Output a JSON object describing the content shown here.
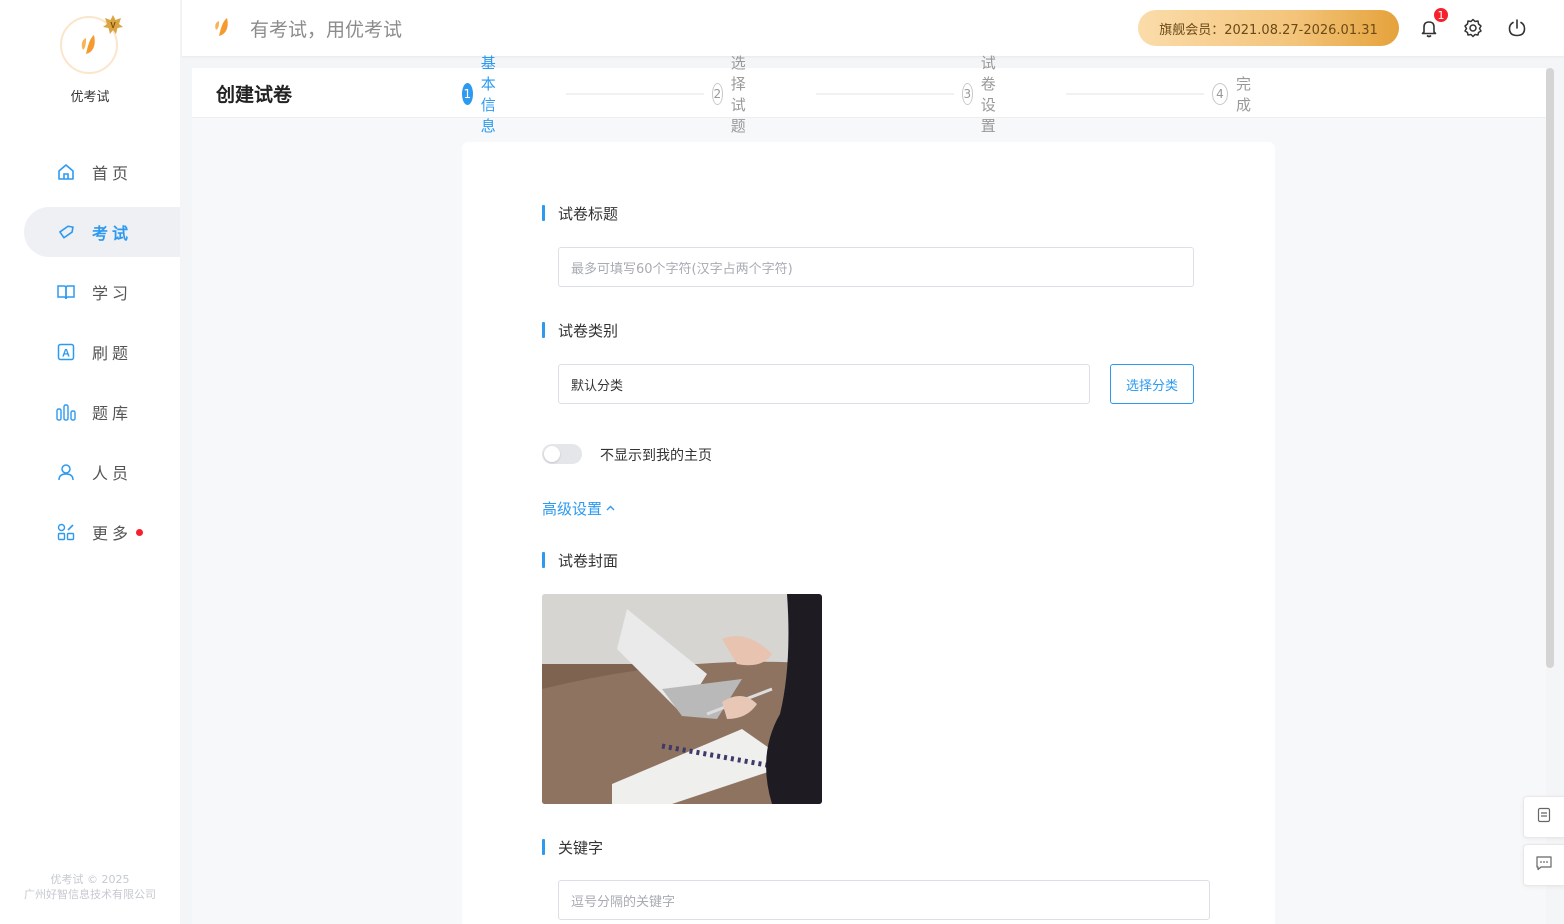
{
  "sidebar": {
    "brand_name": "优考试",
    "nav_items": [
      {
        "label": "首页",
        "icon": "home-icon"
      },
      {
        "label": "考试",
        "icon": "tag-icon",
        "active": true
      },
      {
        "label": "学习",
        "icon": "book-icon"
      },
      {
        "label": "刷题",
        "icon": "letter-a-icon"
      },
      {
        "label": "题库",
        "icon": "bars-icon"
      },
      {
        "label": "人员",
        "icon": "user-icon"
      },
      {
        "label": "更多",
        "icon": "apps-icon",
        "has_dot": true
      }
    ],
    "footer_line1": "优考试 © 2025",
    "footer_line2": "广州好智信息技术有限公司"
  },
  "header": {
    "slogan": "有考试，用优考试",
    "member_badge": "旗舰会员：2021.08.27-2026.01.31",
    "notification_count": "1"
  },
  "page": {
    "title": "创建试卷",
    "steps": [
      {
        "num": "1",
        "label": "基本信息",
        "active": true
      },
      {
        "num": "2",
        "label": "选择试题"
      },
      {
        "num": "3",
        "label": "试卷设置"
      },
      {
        "num": "4",
        "label": "完成"
      }
    ]
  },
  "form": {
    "title_label": "试卷标题",
    "title_placeholder": "最多可填写60个字符(汉字占两个字符)",
    "category_label": "试卷类别",
    "category_value": "默认分类",
    "select_category_button": "选择分类",
    "toggle_label": "不显示到我的主页",
    "advanced_link": "高级设置",
    "cover_label": "试卷封面",
    "keywords_label": "关键字",
    "keywords_placeholder": "逗号分隔的关键字"
  },
  "colors": {
    "accent": "#2d9af0",
    "brand_orange": "#f5a340",
    "badge_red": "#f5222d"
  }
}
